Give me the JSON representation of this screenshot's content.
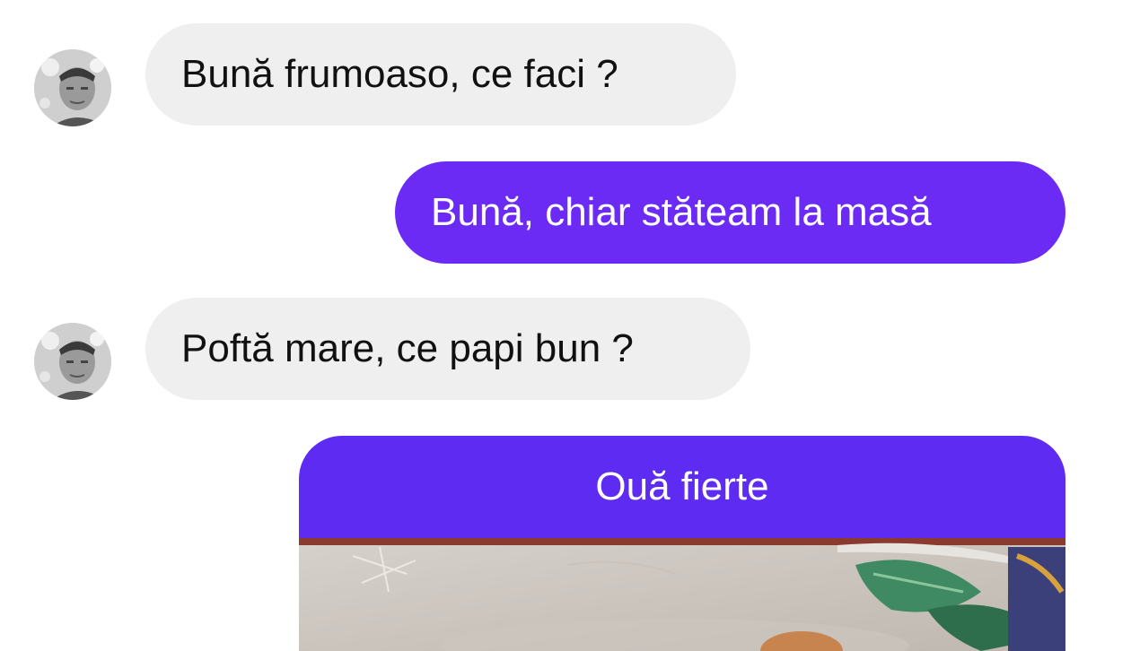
{
  "conversation": {
    "messages": [
      {
        "sender": "contact",
        "text": "Bună frumoaso, ce faci ?"
      },
      {
        "sender": "me",
        "text": "Bună, chiar stăteam la masă"
      },
      {
        "sender": "contact",
        "text": "Poftă mare, ce papi bun ?"
      },
      {
        "sender": "me",
        "caption": "Ouă fierte",
        "attachment": "photo"
      }
    ]
  },
  "colors": {
    "outgoing_bubble": "#6b2bf5",
    "incoming_bubble": "#efefef",
    "background": "#ffffff"
  }
}
